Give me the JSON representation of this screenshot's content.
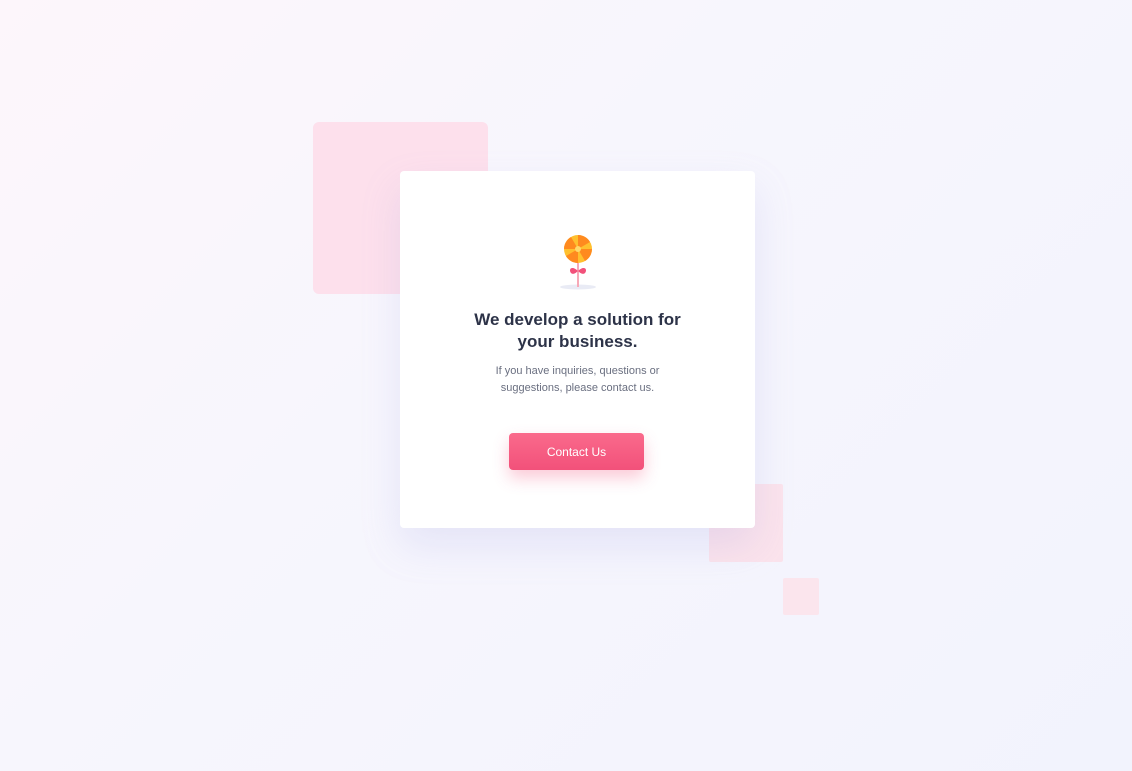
{
  "hero": {
    "illustration": "lollipop-pinwheel-icon",
    "headline": "We develop a solution for your business.",
    "subtext": "If you have inquiries, questions or suggestions, please contact us.",
    "cta_label": "Contact Us"
  },
  "colors": {
    "accent": "#f2517a",
    "heading": "#2d3348",
    "body_text": "#6a6f80",
    "deco_pink": "#fde0ec"
  }
}
